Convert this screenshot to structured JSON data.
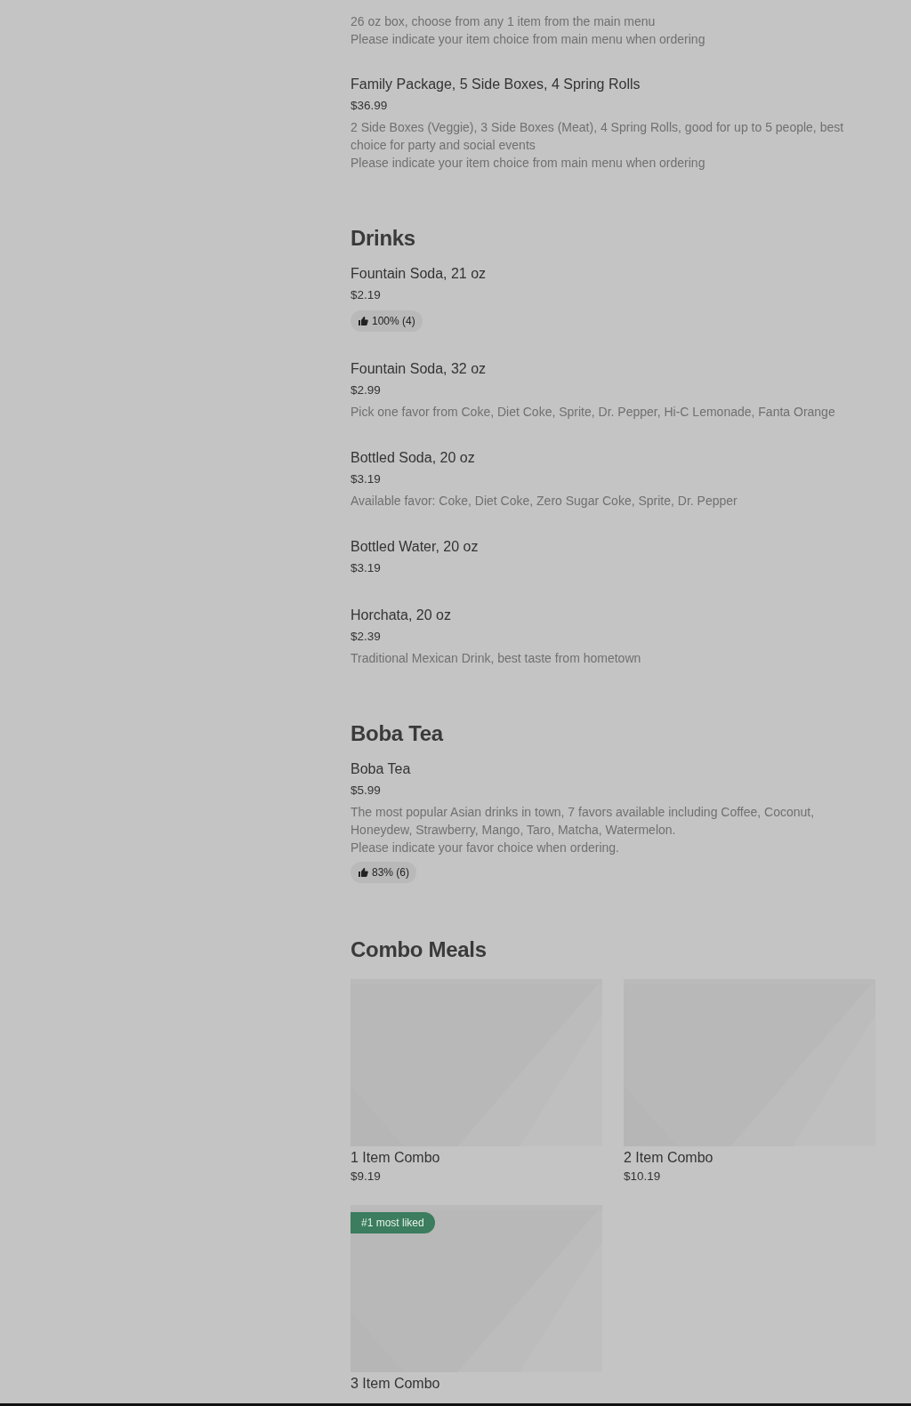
{
  "sections": [
    {
      "items": [
        {
          "description": [
            "26 oz box, choose from any 1 item from the main menu",
            "Please indicate your item choice from main menu when ordering"
          ]
        },
        {
          "name": "Family Package, 5 Side Boxes, 4 Spring Rolls",
          "price": "$36.99",
          "description": [
            "2 Side Boxes (Veggie), 3 Side Boxes (Meat), 4 Spring Rolls, good for up to 5 people, best choice for party and social events",
            "Please indicate your item choice from main menu when ordering"
          ]
        }
      ]
    },
    {
      "title": "Drinks",
      "items": [
        {
          "name": "Fountain Soda, 21 oz",
          "price": "$2.19",
          "rating": "100% (4)"
        },
        {
          "name": "Fountain Soda, 32 oz",
          "price": "$2.99",
          "description": [
            "Pick one favor from Coke, Diet Coke, Sprite, Dr. Pepper, Hi-C Lemonade, Fanta Orange"
          ]
        },
        {
          "name": "Bottled Soda, 20 oz",
          "price": "$3.19",
          "description": [
            "Available favor: Coke, Diet Coke, Zero Sugar Coke, Sprite, Dr. Pepper"
          ]
        },
        {
          "name": "Bottled Water, 20 oz",
          "price": "$3.19"
        },
        {
          "name": "Horchata, 20 oz",
          "price": "$2.39",
          "description": [
            "Traditional Mexican Drink, best taste from hometown"
          ]
        }
      ]
    },
    {
      "title": "Boba Tea",
      "items": [
        {
          "name": "Boba Tea",
          "price": "$5.99",
          "description": [
            "The most popular Asian drinks in town, 7 favors available including Coffee, Coconut, Honeydew, Strawberry, Mango, Taro, Matcha, Watermelon.",
            "Please indicate your favor choice when ordering."
          ],
          "rating": "83% (6)"
        }
      ]
    }
  ],
  "combo": {
    "title": "Combo Meals",
    "cards": [
      {
        "name": "1 Item Combo",
        "price": "$9.19"
      },
      {
        "name": "2 Item Combo",
        "price": "$10.19"
      },
      {
        "badge": "#1 most liked",
        "name": "3 Item Combo"
      }
    ]
  }
}
